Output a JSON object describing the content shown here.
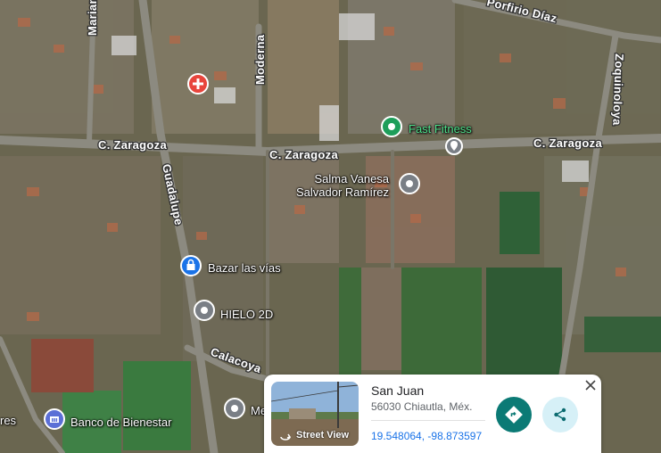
{
  "roads": {
    "zaragoza_left": "C. Zaragoza",
    "zaragoza_center": "C. Zaragoza",
    "zaragoza_right": "C. Zaragoza",
    "guadalupe": "Guadalupe",
    "moderna": "Moderna",
    "mariano": "Mariano",
    "porfirio_diaz": "Porfirio Díaz",
    "zoquinoloya": "Zoquinoloya",
    "calacoya": "Calacoya"
  },
  "pois": {
    "fast_fitness": "Fast Fitness",
    "salma": "Salma Vanesa\nSalvador Ramírez",
    "bazar": "Bazar las vías",
    "hielo": "HIELO 2D",
    "banco": "Banco de Bienestar",
    "me": "Me",
    "res": "res"
  },
  "card": {
    "title": "San Juan",
    "subtitle": "56030 Chiautla, Méx.",
    "coordinates": "19.548064, -98.873597",
    "street_view": "Street View"
  },
  "colors": {
    "accent_teal": "#0b7a75",
    "link_blue": "#1a73e8",
    "fitness_green": "#1e9e5a",
    "health_red": "#e8453c",
    "shop_blue": "#1a73e8",
    "bank_blue": "#5b6fd6",
    "pin_gray": "#7a7f86"
  },
  "icons": [
    "hospital-icon",
    "fitness-icon",
    "location-pin-icon",
    "shopping-bag-icon",
    "bank-icon",
    "street-view-icon",
    "directions-icon",
    "share-icon",
    "close-icon"
  ]
}
